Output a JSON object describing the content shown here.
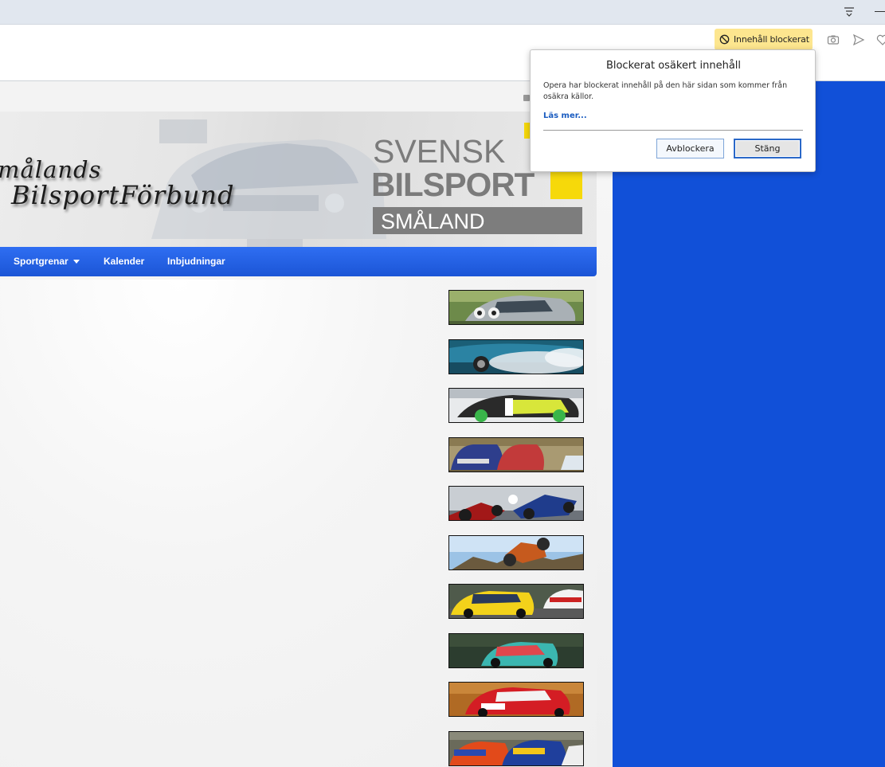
{
  "browser": {
    "blocked_badge_label": "Innehåll blockerat"
  },
  "site": {
    "name_line1": "målands",
    "name_line2": "BilsportFörbund",
    "logo": {
      "line1": "SVENSK",
      "line2": "BILSPORT",
      "line3": "SMÅLAND"
    },
    "nav": [
      {
        "label": "Sportgrenar"
      },
      {
        "label": "Kalender"
      },
      {
        "label": "Inbjudningar"
      }
    ],
    "sport_thumbnails": [
      {
        "name": "rally"
      },
      {
        "name": "drifting-smoke"
      },
      {
        "name": "drifting"
      },
      {
        "name": "folkrace"
      },
      {
        "name": "karting"
      },
      {
        "name": "offroad-truck"
      },
      {
        "name": "racing-yellow"
      },
      {
        "name": "racing-teal"
      },
      {
        "name": "rally-red"
      },
      {
        "name": "rallycross"
      }
    ]
  },
  "popup": {
    "title": "Blockerat osäkert innehåll",
    "body": "Opera har blockerat innehåll på den här sidan som kommer från osäkra källor.",
    "link": "Läs mer...",
    "unblock_button": "Avblockera",
    "close_button": "Stäng"
  },
  "colors": {
    "page_background_right": "#1150d8",
    "navbar": "#2361e8",
    "badge": "#fde68f",
    "logo_yellow": "#f6d90a",
    "link": "#1a5cc0"
  }
}
